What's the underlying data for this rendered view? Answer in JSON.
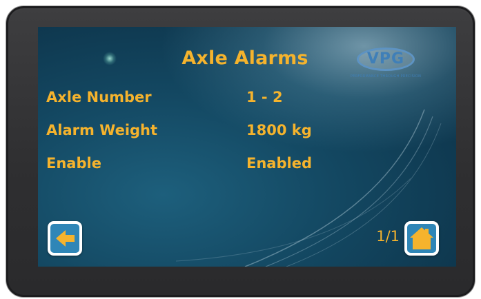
{
  "screen": {
    "title": "Axle Alarms",
    "logo": {
      "text": "VPG",
      "tagline": "PERFORMANCE THROUGH PRECISION"
    },
    "fields": [
      {
        "label": "Axle Number",
        "value": "1 - 2"
      },
      {
        "label": "Alarm Weight",
        "value": "1800 kg"
      },
      {
        "label": "Enable",
        "value": "Enabled"
      }
    ],
    "page_indicator": "1/1"
  },
  "nav": {
    "back_icon": "arrow-left-icon",
    "home_icon": "home-icon"
  },
  "colors": {
    "text_accent": "#f5b32d",
    "screen_bg": "#134761",
    "button_bg": "#2f86b7",
    "bezel": "#2f2f31"
  }
}
